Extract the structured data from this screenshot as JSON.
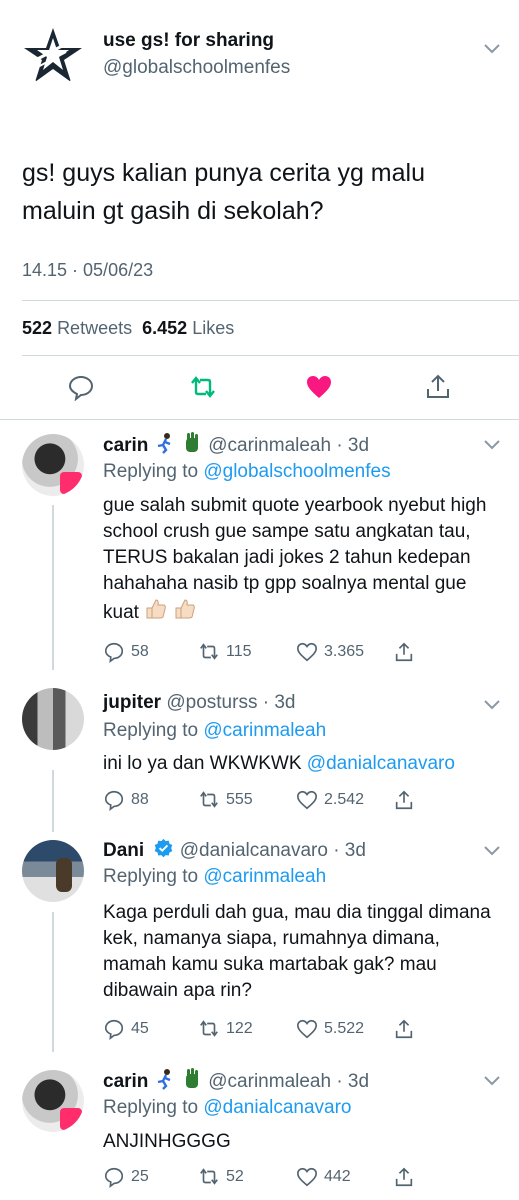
{
  "main": {
    "name": "use gs! for sharing",
    "handle": "@globalschoolmenfes",
    "text": "gs! guys kalian punya cerita yg malu maluin gt gasih di sekolah?",
    "time": "14.15 · 05/06/23",
    "retweets_count": "522",
    "retweets_label": "Retweets",
    "likes_count": "6.452",
    "likes_label": "Likes",
    "liked_color": "#f91880"
  },
  "replies": [
    {
      "name": "carin",
      "emoji": [
        "runner-emoji",
        "raised-back-of-hand-emoji"
      ],
      "handle_time": "@carinmaleah · 3d",
      "replying_prefix": "Replying to",
      "replying_to": "@globalschoolmenfes",
      "text": "gue salah submit quote yearbook nyebut high school crush gue sampe satu angkatan tau, TERUS bakalan jadi jokes 2 tahun kedepan hahahaha nasib tp gpp soalnya mental gue kuat",
      "text_emoji": "thumbs-up-emoji ×2",
      "replies": "58",
      "retweets": "115",
      "likes": "3.365"
    },
    {
      "name": "jupiter",
      "handle_time": "@posturss · 3d",
      "replying_prefix": "Replying to",
      "replying_to": "@carinmaleah",
      "text": "ini lo ya dan WKWKWK",
      "mention": "@danialcanavaro",
      "replies": "88",
      "retweets": "555",
      "likes": "2.542"
    },
    {
      "name": "Dani",
      "verified": true,
      "handle_time": "@danialcanavaro · 3d",
      "replying_prefix": "Replying to",
      "replying_to": "@carinmaleah",
      "text": "Kaga perduli dah gua, mau dia tinggal dimana kek, namanya siapa, rumahnya dimana, mamah kamu suka martabak gak? mau dibawain apa rin?",
      "replies": "45",
      "retweets": "122",
      "likes": "5.522"
    },
    {
      "name": "carin",
      "emoji": [
        "runner-emoji",
        "raised-back-of-hand-emoji"
      ],
      "handle_time": "@carinmaleah · 3d",
      "replying_prefix": "Replying to",
      "replying_to": "@danialcanavaro",
      "text": "ANJINHGGGG",
      "replies": "25",
      "retweets": "52",
      "likes": "442"
    }
  ],
  "colors": {
    "link": "#1d9bf0",
    "secondary": "#536471",
    "retweet_green": "#00ba7c",
    "like_pink": "#f91880",
    "verified_blue": "#1d9bf0"
  }
}
